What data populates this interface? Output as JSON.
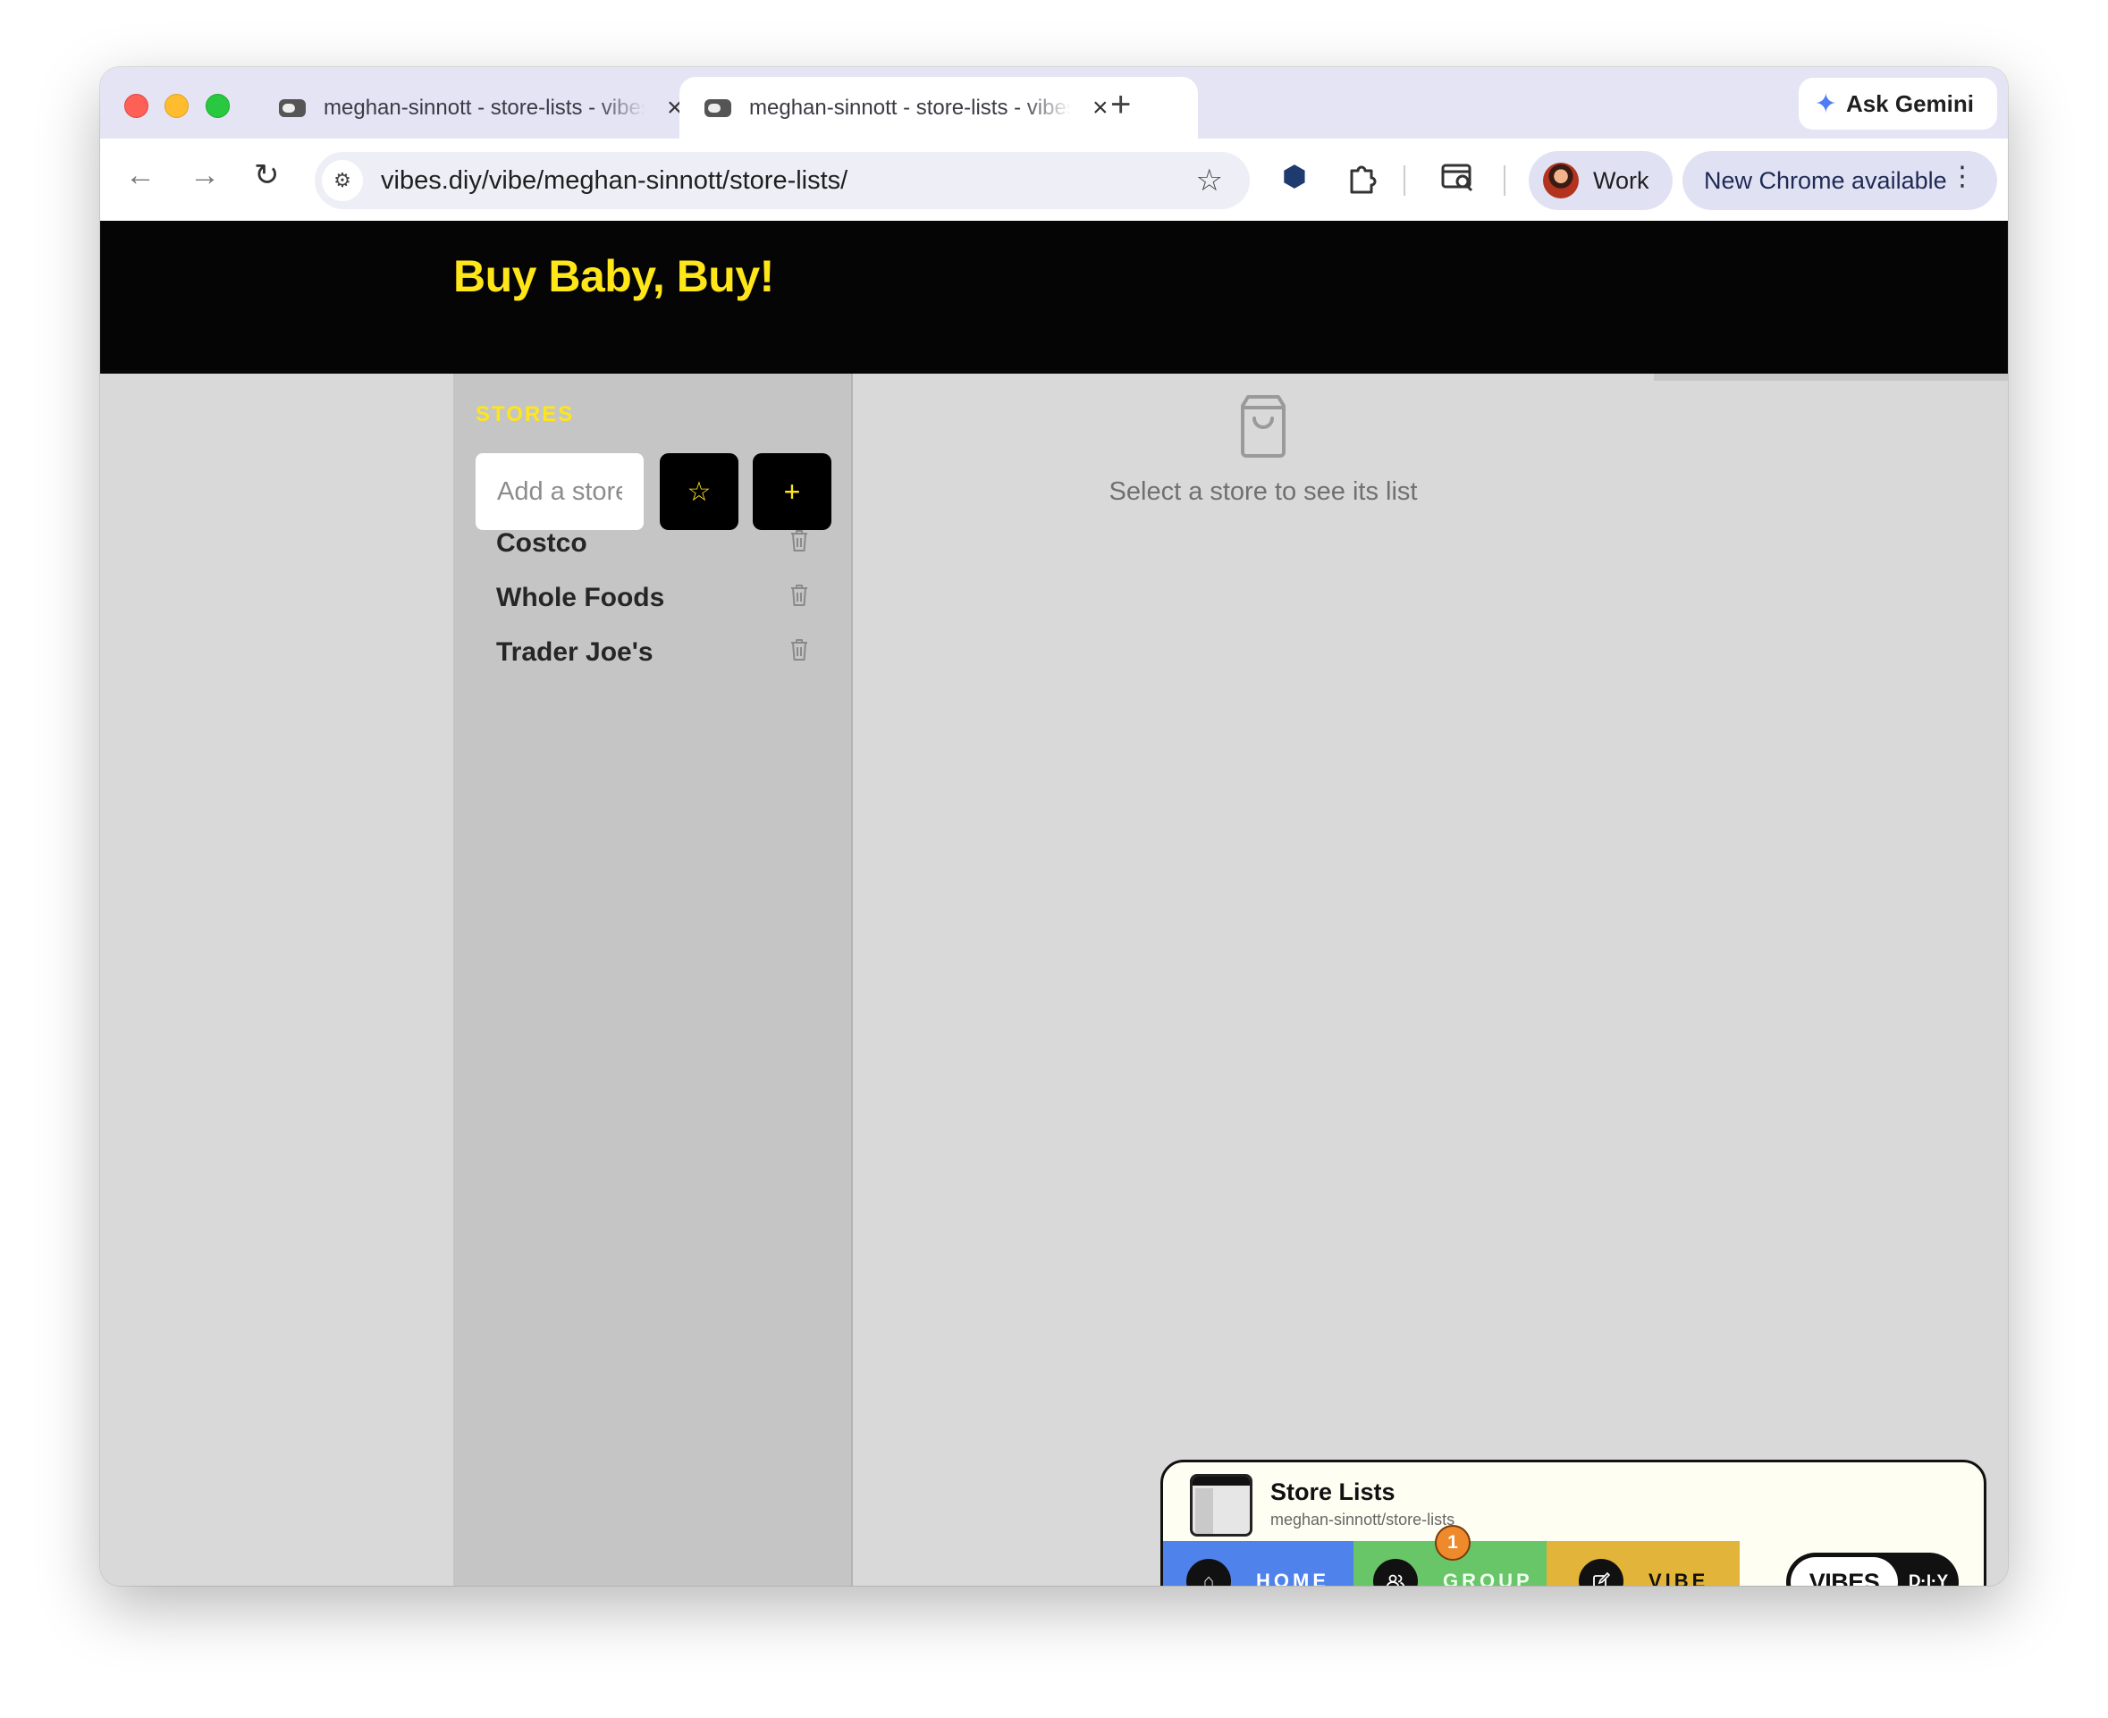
{
  "browser": {
    "tabs": [
      {
        "title": "meghan-sinnott - store-lists - vibes.diy"
      },
      {
        "title": "meghan-sinnott - store-lists - vibes.diy"
      }
    ],
    "new_tab_label": "+",
    "gemini_label": "Ask Gemini",
    "url": "vibes.diy/vibe/meghan-sinnott/store-lists/",
    "profile_label": "Work",
    "update_label": "New Chrome available"
  },
  "app": {
    "title": "Buy Baby, Buy!",
    "sidebar": {
      "section_label": "STORES",
      "input_placeholder": "Add a store",
      "favorite_button_label": "☆",
      "add_button_label": "+",
      "stores": [
        {
          "name": "Costco"
        },
        {
          "name": "Whole Foods"
        },
        {
          "name": "Trader Joe's"
        }
      ]
    },
    "empty_state": {
      "icon": "shopping-bag-icon",
      "message": "Select a store to see its list"
    }
  },
  "vibes_widget": {
    "title": "Store Lists",
    "subtitle": "meghan-sinnott/store-lists",
    "tabs": {
      "home": "HOME",
      "group": "GROUP",
      "vibe": "VIBE"
    },
    "group_badge": "1",
    "logo_left": "VIBES",
    "logo_right": "D·I·Y",
    "colors": {
      "home": "#4f82ea",
      "group": "#68c568",
      "vibe": "#e3b43a"
    }
  },
  "colors": {
    "accent_yellow": "#ffe619",
    "header_bg": "#050505",
    "sidebar_bg": "#c5c5c5",
    "content_bg": "#d9d9d9"
  }
}
